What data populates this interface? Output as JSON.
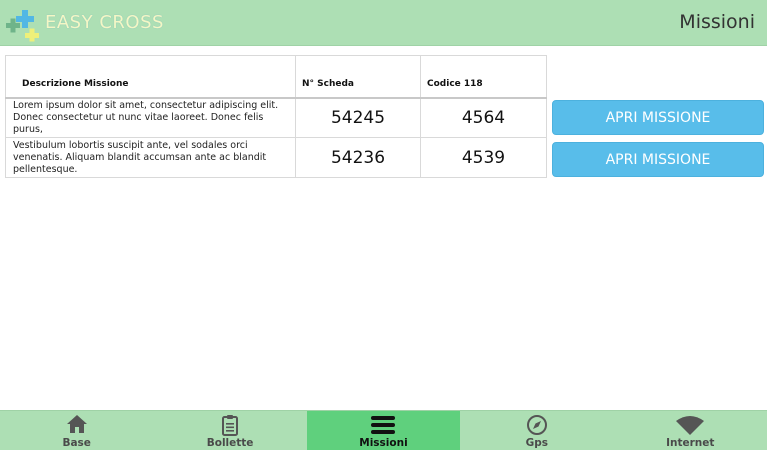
{
  "header": {
    "brand": "EASY CROSS",
    "title": "Missioni"
  },
  "table": {
    "headers": {
      "description": "Descrizione Missione",
      "scheda": "N° Scheda",
      "codice": "Codice 118"
    },
    "rows": [
      {
        "description": "Lorem ipsum dolor sit amet, consectetur adipiscing elit. Donec consectetur ut nunc vitae laoreet. Donec felis purus,",
        "scheda": "54245",
        "codice": "4564",
        "action": "APRI MISSIONE"
      },
      {
        "description": "Vestibulum lobortis suscipit ante, vel sodales orci venenatis. Aliquam blandit accumsan ante ac blandit pellentesque.",
        "scheda": "54236",
        "codice": "4539",
        "action": "APRI MISSIONE"
      }
    ]
  },
  "tabbar": {
    "tabs": [
      {
        "label": "Base",
        "icon": "home-icon"
      },
      {
        "label": "Bollette",
        "icon": "clipboard-icon"
      },
      {
        "label": "Missioni",
        "icon": "menu-icon",
        "active": true
      },
      {
        "label": "Gps",
        "icon": "compass-icon"
      },
      {
        "label": "Internet",
        "icon": "wifi-icon"
      }
    ]
  },
  "colors": {
    "header_bg": "#addfb4",
    "active_tab": "#5fd07d",
    "button": "#58bdea"
  }
}
